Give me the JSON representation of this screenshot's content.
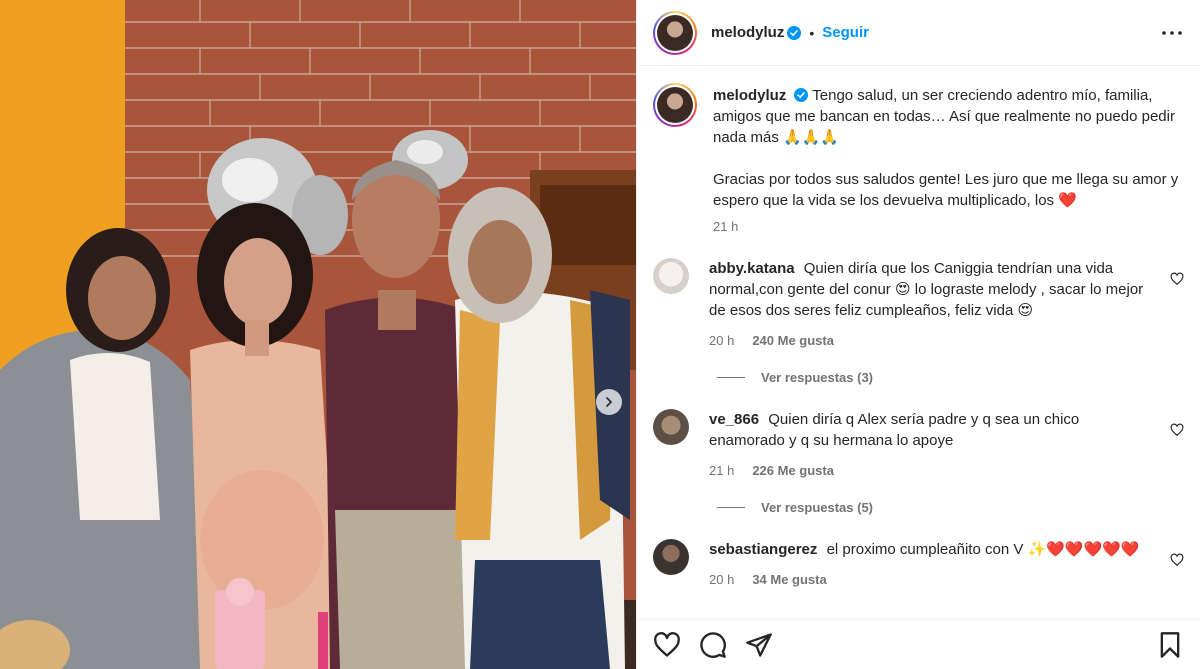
{
  "post": {
    "username": "melodyluz",
    "separator": "•",
    "follow_label": "Seguir",
    "caption_line1": "Tengo salud, un ser creciendo adentro mío, familia, amigos que me bancan en todas… Así que realmente no puedo pedir nada más 🙏🙏🙏",
    "caption_line2": "Gracias por todos sus saludos gente! Les juro que me llega su amor y espero que la vida se los devuelva multiplicado, los",
    "caption_heart": "❤️",
    "time": "21 h"
  },
  "comments": [
    {
      "username": "abby.katana",
      "text": "Quien diría que los Caniggia tendrían una vida normal,con gente del conur 😍 lo lograste melody , sacar lo mejor de esos dos seres feliz cumpleaños, feliz vida 😍",
      "time": "20 h",
      "likes": "240 Me gusta",
      "replies": "Ver respuestas (3)"
    },
    {
      "username": "ve_866",
      "text": "Quien diría q Alex sería padre y q sea un chico enamorado y q su hermana lo apoye",
      "time": "21 h",
      "likes": "226 Me gusta",
      "replies": "Ver respuestas (5)"
    },
    {
      "username": "sebastiangerez",
      "text": "el proximo cumpleañito con V ✨❤️❤️❤️❤️❤️",
      "time": "20 h",
      "likes": "34 Me gusta"
    }
  ],
  "colors": {
    "accent": "#0095f6",
    "text": "#262626",
    "muted": "#737373",
    "heart": "#ed4956"
  },
  "icons": [
    "verified-badge-icon",
    "more-options-icon",
    "heart-icon",
    "comment-icon",
    "share-icon",
    "save-icon",
    "chevron-right-icon"
  ]
}
